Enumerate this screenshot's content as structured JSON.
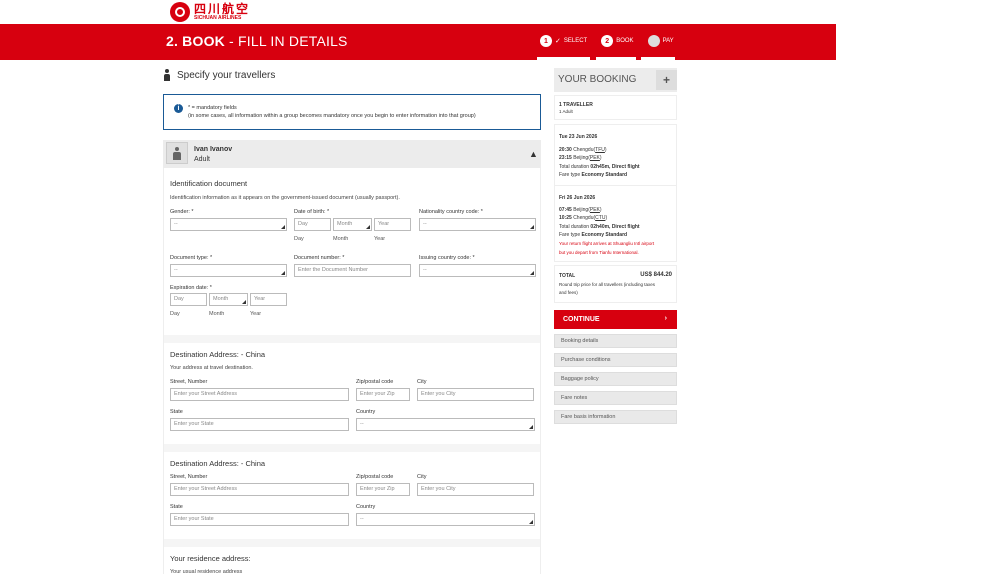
{
  "brand": {
    "name_cn": "四川航空",
    "name_en": "SICHUAN AIRLINES"
  },
  "header": {
    "title_bold": "2. BOOK",
    "title_rest": " - FILL IN DETAILS",
    "steps": [
      {
        "num": "1",
        "label": "SELECT",
        "done": true
      },
      {
        "num": "2",
        "label": "BOOK",
        "current": true
      },
      {
        "num": "",
        "label": "PAY"
      }
    ]
  },
  "main": {
    "section_title": "Specify your travellers",
    "info": {
      "line1": "* = mandatory fields",
      "line2": "(in some cases, all information within a group becomes mandatory once you begin to enter information into that group)"
    },
    "traveller": {
      "name": "Ivan  Ivanov",
      "type": "Adult"
    },
    "id_doc": {
      "title": "Identification document",
      "desc": "Identification information as it appears on the government-issued document (usually passport).",
      "gender_label": "Gender: *",
      "gender_value": "--",
      "dob_label": "Date of birth: *",
      "dob_day": "Day",
      "dob_month": "Month",
      "dob_year": "Year",
      "sub_day": "Day",
      "sub_month": "Month",
      "sub_year": "Year",
      "nationality_label": "Nationality country code: *",
      "nationality_value": "--",
      "doctype_label": "Document type: *",
      "doctype_value": "--",
      "docnum_label": "Document number: *",
      "docnum_placeholder": "Enter the Document Number",
      "issuing_label": "Issuing country code: *",
      "issuing_value": "--",
      "exp_label": "Expiration date: *",
      "exp_day": "Day",
      "exp_month": "Month",
      "exp_year": "Year",
      "exp_sub_day": "Day",
      "exp_sub_month": "Month",
      "exp_sub_year": "Year"
    },
    "dest1": {
      "title": "Destination Address: - China",
      "desc": "Your address at travel destination.",
      "street_label": "Street, Number",
      "street_placeholder": "Enter your Street Address",
      "zip_label": "Zip/postal code",
      "zip_placeholder": "Enter your Zip",
      "city_label": "City",
      "city_placeholder": "Enter you City",
      "state_label": "State",
      "state_placeholder": "Enter your State",
      "country_label": "Country",
      "country_value": "--"
    },
    "dest2": {
      "title": "Destination Address: - China",
      "street_label": "Street, Number",
      "street_placeholder": "Enter your Street Address",
      "zip_label": "Zip/postal code",
      "zip_placeholder": "Enter your Zip",
      "city_label": "City",
      "city_placeholder": "Enter you City",
      "state_label": "State",
      "state_placeholder": "Enter your State",
      "country_label": "Country",
      "country_value": "--"
    },
    "residence": {
      "title": "Your residence address:",
      "desc": "Your usual residence address"
    }
  },
  "booking": {
    "title": "YOUR BOOKING",
    "plus": "+",
    "travellers": "1 TRAVELLER",
    "travellers_sub": "1 Adult",
    "out": {
      "date": "Tue 23 Jun 2026",
      "dep_time": "20:30",
      "dep_city": "Chengdu",
      "dep_code": "TFU",
      "arr_time": "23:15",
      "arr_city": "Beijing",
      "arr_code": "PEK",
      "duration_label": "Total duration",
      "duration": "02h45m, Direct flight",
      "fare_label": "Fare type",
      "fare": "Economy Standard"
    },
    "ret": {
      "date": "Fri 26 Jun 2026",
      "dep_time": "07:45",
      "dep_city": "Beijing",
      "dep_code": "PEK",
      "arr_time": "10:25",
      "arr_city": "Chengdu",
      "arr_code": "CTU",
      "duration_label": "Total duration",
      "duration": "02h40m, Direct flight",
      "fare_label": "Fare type",
      "fare": "Economy Standard",
      "warn1": "Your return flight arrives at Shuangliu Intl airport",
      "warn2": "but you depart from Tianfu International."
    },
    "total_label": "TOTAL",
    "currency": "US$",
    "total": "844.20",
    "total_note1": "Round trip price for all travellers (including taxes",
    "total_note2": "and fees)",
    "continue": "CONTINUE",
    "continue_arrow": "›",
    "links": [
      "Booking details",
      "Purchase conditions",
      "Baggage policy",
      "Fare notes",
      "Fare basis information"
    ]
  }
}
